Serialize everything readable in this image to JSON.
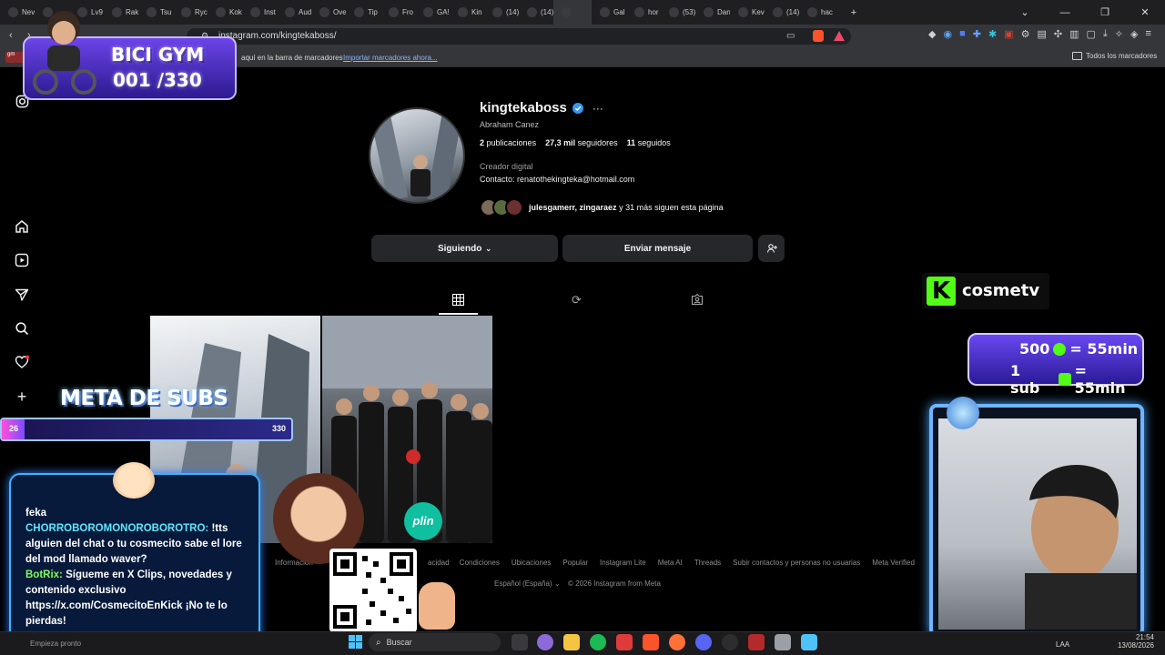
{
  "browser": {
    "tabs": [
      {
        "label": "Nev"
      },
      {
        "label": ""
      },
      {
        "label": "Lv9"
      },
      {
        "label": "Rak"
      },
      {
        "label": "Tsu"
      },
      {
        "label": "Ryc"
      },
      {
        "label": "Kok"
      },
      {
        "label": "Inst"
      },
      {
        "label": "Aud"
      },
      {
        "label": "Ove"
      },
      {
        "label": "Tip"
      },
      {
        "label": "Fro"
      },
      {
        "label": "GA!"
      },
      {
        "label": "Kin"
      },
      {
        "label": "(14)"
      },
      {
        "label": "(14)"
      },
      {
        "label": ""
      },
      {
        "label": "Gal"
      },
      {
        "label": "hor"
      },
      {
        "label": "(53)"
      },
      {
        "label": "Dan"
      },
      {
        "label": "Kev"
      },
      {
        "label": "(14)"
      },
      {
        "label": "hac"
      }
    ],
    "url": "instagram.com/kingtekaboss/",
    "bookmarks": {
      "hint": "aquí en la barra de marcadores",
      "import_link": "Importar marcadores ahora...",
      "all_bookmarks": "Todos los marcadores"
    }
  },
  "profile": {
    "username": "kingtekaboss",
    "full_name": "Abraham Canez",
    "posts_count": "2",
    "posts_label": "publicaciones",
    "followers_count": "27,3 mil",
    "followers_label": "seguidores",
    "following_count": "11",
    "following_label": "seguidos",
    "category": "Creador digital",
    "contact": "Contacto: renatothekingteka@hotmail.com",
    "followed_by_names": "julesgamerr, zingaraez",
    "followed_by_rest": "y 31 más siguen esta página",
    "following_button": "Siguiendo",
    "message_button": "Enviar mensaje"
  },
  "footer": {
    "links": [
      "Información",
      "Condiciones",
      "Ubicaciones",
      "Popular",
      "Instagram Lite",
      "Meta AI",
      "Threads",
      "Subir contactos y personas no usuarias",
      "Meta Verified"
    ],
    "partial_link": "acidad",
    "language": "Español (España)",
    "copyright": "© 2026 Instagram from Meta"
  },
  "overlays": {
    "bici_gym_title": "BICI GYM",
    "bici_gym_count": "001 /330",
    "meta_subs_title": "META DE SUBS",
    "meta_subs_current": "26",
    "meta_subs_goal": "330",
    "meta_subs_progress": 0.079,
    "kick_channel": "cosmetv",
    "sub_rule_1": "500",
    "sub_rule_1_tail": "= 55min",
    "sub_rule_2": "1 sub",
    "sub_rule_2_tail": "= 55min",
    "plin": "plin",
    "chat": [
      {
        "user": "feka",
        "text": "",
        "user_color": "#ffffff"
      },
      {
        "user": "CHORROBOROMONOROBOROTRO:",
        "text": "!tts alguien del chat o tu cosmecito sabe el lore del mod llamado waver?",
        "user_color": "#5ee6ff"
      },
      {
        "user": "BotRix:",
        "text": "Sígueme en X Clips, novedades y contenido exclusivo https://x.com/CosmecitoEnKick ¡No te lo pierdas!",
        "user_color": "#7cff5a"
      }
    ]
  },
  "taskbar": {
    "search_placeholder": "Buscar",
    "language": "LAA",
    "time": "21:54",
    "date": "13/08/2026",
    "start_hint": "Empieza pronto"
  },
  "colors": {
    "ig_background": "#000000",
    "verified_badge": "#3897f0",
    "button_bg": "#26272b",
    "overlay_purple": "#5b3de0",
    "overlay_blue_glow": "#37b6ff"
  }
}
